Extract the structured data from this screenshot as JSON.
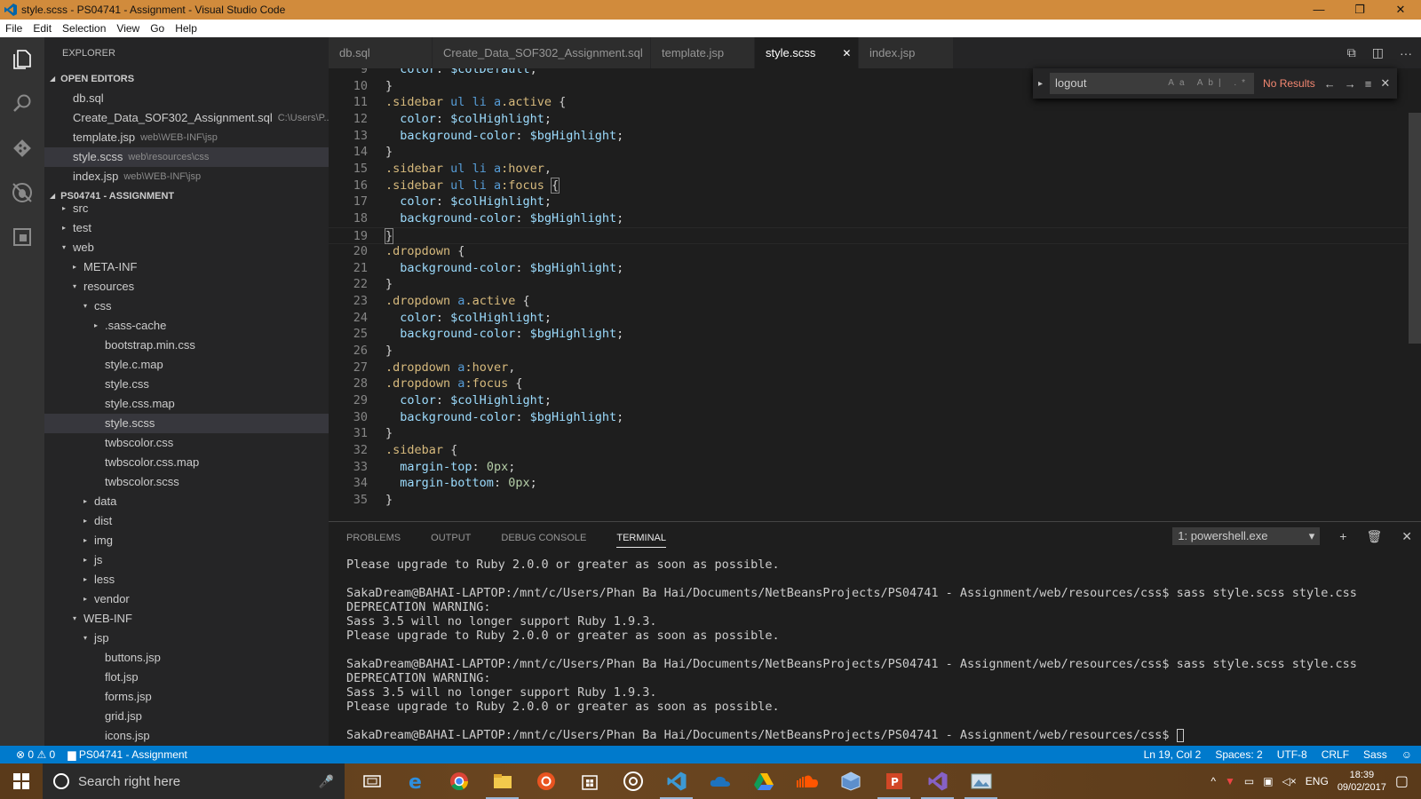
{
  "window": {
    "title": "style.scss - PS04741 - Assignment - Visual Studio Code",
    "controls": [
      "—",
      "❐",
      "✕"
    ]
  },
  "menu": [
    "File",
    "Edit",
    "Selection",
    "View",
    "Go",
    "Help"
  ],
  "activity_icons": [
    "explorer-icon",
    "search-icon",
    "git-icon",
    "debug-icon",
    "extensions-icon"
  ],
  "sidebar": {
    "title": "EXPLORER",
    "open_editors_label": "OPEN EDITORS",
    "open_editors": [
      {
        "name": "db.sql",
        "desc": ""
      },
      {
        "name": "Create_Data_SOF302_Assignment.sql",
        "desc": "C:\\Users\\P..."
      },
      {
        "name": "template.jsp",
        "desc": "web\\WEB-INF\\jsp"
      },
      {
        "name": "style.scss",
        "desc": "web\\resources\\css"
      },
      {
        "name": "index.jsp",
        "desc": "web\\WEB-INF\\jsp"
      }
    ],
    "project_label": "PS04741 - ASSIGNMENT",
    "tree": [
      {
        "name": "src",
        "depth": 0,
        "arrow": "▸"
      },
      {
        "name": "test",
        "depth": 0,
        "arrow": "▸"
      },
      {
        "name": "web",
        "depth": 0,
        "arrow": "▾"
      },
      {
        "name": "META-INF",
        "depth": 1,
        "arrow": "▸"
      },
      {
        "name": "resources",
        "depth": 1,
        "arrow": "▾"
      },
      {
        "name": "css",
        "depth": 2,
        "arrow": "▾"
      },
      {
        "name": ".sass-cache",
        "depth": 3,
        "arrow": "▸"
      },
      {
        "name": "bootstrap.min.css",
        "depth": 3,
        "arrow": ""
      },
      {
        "name": "style.c.map",
        "depth": 3,
        "arrow": ""
      },
      {
        "name": "style.css",
        "depth": 3,
        "arrow": ""
      },
      {
        "name": "style.css.map",
        "depth": 3,
        "arrow": ""
      },
      {
        "name": "style.scss",
        "depth": 3,
        "arrow": ""
      },
      {
        "name": "twbscolor.css",
        "depth": 3,
        "arrow": ""
      },
      {
        "name": "twbscolor.css.map",
        "depth": 3,
        "arrow": ""
      },
      {
        "name": "twbscolor.scss",
        "depth": 3,
        "arrow": ""
      },
      {
        "name": "data",
        "depth": 2,
        "arrow": "▸"
      },
      {
        "name": "dist",
        "depth": 2,
        "arrow": "▸"
      },
      {
        "name": "img",
        "depth": 2,
        "arrow": "▸"
      },
      {
        "name": "js",
        "depth": 2,
        "arrow": "▸"
      },
      {
        "name": "less",
        "depth": 2,
        "arrow": "▸"
      },
      {
        "name": "vendor",
        "depth": 2,
        "arrow": "▸"
      },
      {
        "name": "WEB-INF",
        "depth": 1,
        "arrow": "▾"
      },
      {
        "name": "jsp",
        "depth": 2,
        "arrow": "▾"
      },
      {
        "name": "buttons.jsp",
        "depth": 3,
        "arrow": ""
      },
      {
        "name": "flot.jsp",
        "depth": 3,
        "arrow": ""
      },
      {
        "name": "forms.jsp",
        "depth": 3,
        "arrow": ""
      },
      {
        "name": "grid.jsp",
        "depth": 3,
        "arrow": ""
      },
      {
        "name": "icons.jsp",
        "depth": 3,
        "arrow": ""
      }
    ]
  },
  "tabs": [
    {
      "label": "db.sql",
      "active": false
    },
    {
      "label": "Create_Data_SOF302_Assignment.sql",
      "active": false
    },
    {
      "label": "template.jsp",
      "active": false
    },
    {
      "label": "style.scss",
      "active": true
    },
    {
      "label": "index.jsp",
      "active": false
    }
  ],
  "find": {
    "value": "logout",
    "result": "No Results",
    "options": "Aa Ab| .*"
  },
  "code_lines": [
    {
      "n": "9",
      "text": "  color: $colDefault;"
    },
    {
      "n": "10",
      "text": "}"
    },
    {
      "n": "11",
      "text": ".sidebar ul li a.active {"
    },
    {
      "n": "12",
      "text": "  color: $colHighlight;"
    },
    {
      "n": "13",
      "text": "  background-color: $bgHighlight;"
    },
    {
      "n": "14",
      "text": "}"
    },
    {
      "n": "15",
      "text": ".sidebar ul li a:hover,"
    },
    {
      "n": "16",
      "text": ".sidebar ul li a:focus {"
    },
    {
      "n": "17",
      "text": "  color: $colHighlight;"
    },
    {
      "n": "18",
      "text": "  background-color: $bgHighlight;"
    },
    {
      "n": "19",
      "text": "}"
    },
    {
      "n": "20",
      "text": ".dropdown {"
    },
    {
      "n": "21",
      "text": "  background-color: $bgHighlight;"
    },
    {
      "n": "22",
      "text": "}"
    },
    {
      "n": "23",
      "text": ".dropdown a.active {"
    },
    {
      "n": "24",
      "text": "  color: $colHighlight;"
    },
    {
      "n": "25",
      "text": "  background-color: $bgHighlight;"
    },
    {
      "n": "26",
      "text": "}"
    },
    {
      "n": "27",
      "text": ".dropdown a:hover,"
    },
    {
      "n": "28",
      "text": ".dropdown a:focus {"
    },
    {
      "n": "29",
      "text": "  color: $colHighlight;"
    },
    {
      "n": "30",
      "text": "  background-color: $bgHighlight;"
    },
    {
      "n": "31",
      "text": "}"
    },
    {
      "n": "32",
      "text": ".sidebar {"
    },
    {
      "n": "33",
      "text": "  margin-top: 0px;"
    },
    {
      "n": "34",
      "text": "  margin-bottom: 0px;"
    },
    {
      "n": "35",
      "text": "}"
    }
  ],
  "panel": {
    "tabs": [
      "PROBLEMS",
      "OUTPUT",
      "DEBUG CONSOLE",
      "TERMINAL"
    ],
    "active_tab": "TERMINAL",
    "terminal_select": "1: powershell.exe",
    "terminal_lines": [
      "Please upgrade to Ruby 2.0.0 or greater as soon as possible.",
      "",
      "SakaDream@BAHAI-LAPTOP:/mnt/c/Users/Phan Ba Hai/Documents/NetBeansProjects/PS04741 - Assignment/web/resources/css$ sass style.scss style.css",
      "DEPRECATION WARNING:",
      "Sass 3.5 will no longer support Ruby 1.9.3.",
      "Please upgrade to Ruby 2.0.0 or greater as soon as possible.",
      "",
      "SakaDream@BAHAI-LAPTOP:/mnt/c/Users/Phan Ba Hai/Documents/NetBeansProjects/PS04741 - Assignment/web/resources/css$ sass style.scss style.css",
      "DEPRECATION WARNING:",
      "Sass 3.5 will no longer support Ruby 1.9.3.",
      "Please upgrade to Ruby 2.0.0 or greater as soon as possible.",
      "",
      "SakaDream@BAHAI-LAPTOP:/mnt/c/Users/Phan Ba Hai/Documents/NetBeansProjects/PS04741 - Assignment/web/resources/css$ "
    ]
  },
  "status": {
    "errors": "0",
    "warnings": "0",
    "folder": "PS04741 - Assignment",
    "position": "Ln 19, Col 2",
    "spaces": "Spaces: 2",
    "encoding": "UTF-8",
    "eol": "CRLF",
    "language": "Sass"
  },
  "taskbar": {
    "search_placeholder": "Search right here",
    "apps": [
      "task-view-icon",
      "edge-icon",
      "chrome-icon",
      "file-explorer-icon",
      "ubuntu-icon",
      "store-icon",
      "groove-icon",
      "vscode-icon",
      "onedrive-icon",
      "drive-icon",
      "soundcloud-icon",
      "virtualbox-icon",
      "powerpoint-icon",
      "visual-studio-icon",
      "photo-viewer-icon"
    ],
    "lang": "ENG",
    "time": "18:39",
    "date": "09/02/2017"
  },
  "colors": {
    "title_bar": "#d18b3c",
    "status_bar": "#007acc",
    "editor_bg": "#1e1e1e",
    "sidebar_bg": "#252526",
    "activity_bg": "#333333"
  }
}
